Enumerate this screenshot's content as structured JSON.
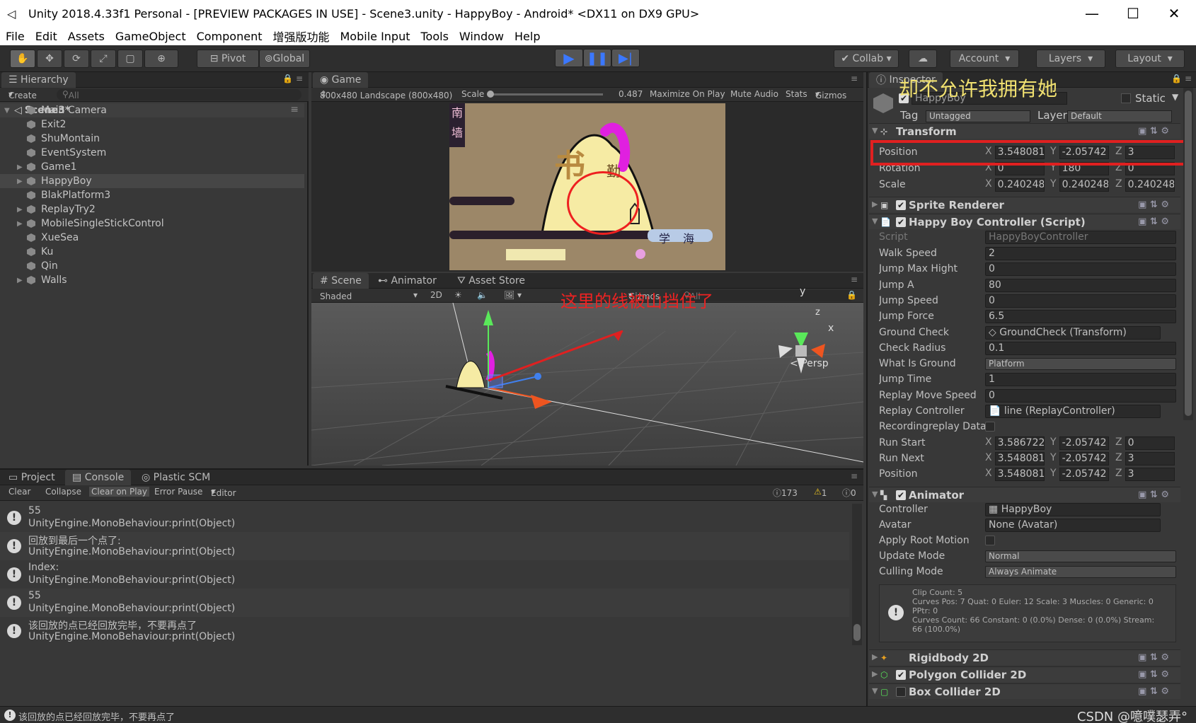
{
  "window": {
    "title": "Unity 2018.4.33f1 Personal - [PREVIEW PACKAGES IN USE] - Scene3.unity - HappyBoy - Android* <DX11 on DX9 GPU>",
    "min": "—",
    "max": "☐",
    "close": "✕"
  },
  "menu": [
    "File",
    "Edit",
    "Assets",
    "GameObject",
    "Component",
    "增强版功能",
    "Mobile Input",
    "Tools",
    "Window",
    "Help"
  ],
  "toolbar": {
    "pivot": "Pivot",
    "global": "Global",
    "collab": "Collab",
    "account": "Account",
    "layers": "Layers",
    "layout": "Layout"
  },
  "hierarchy": {
    "tab": "Hierarchy",
    "create": "Create",
    "search": "All",
    "scene": "Scene3*",
    "items": [
      {
        "name": "Main Camera",
        "expand": false,
        "selected": false
      },
      {
        "name": "Exit2",
        "expand": false,
        "selected": false
      },
      {
        "name": "ShuMontain",
        "expand": false,
        "selected": false
      },
      {
        "name": "EventSystem",
        "expand": false,
        "selected": false
      },
      {
        "name": "Game1",
        "expand": true,
        "selected": false
      },
      {
        "name": "HappyBoy",
        "expand": true,
        "selected": true
      },
      {
        "name": "BlakPlatform3",
        "expand": false,
        "selected": false
      },
      {
        "name": "ReplayTry2",
        "expand": true,
        "selected": false
      },
      {
        "name": "MobileSingleStickControl",
        "expand": true,
        "selected": false
      },
      {
        "name": "XueSea",
        "expand": false,
        "selected": false
      },
      {
        "name": "Ku",
        "expand": false,
        "selected": false
      },
      {
        "name": "Qin",
        "expand": false,
        "selected": false
      },
      {
        "name": "Walls",
        "expand": true,
        "selected": false
      }
    ]
  },
  "game": {
    "tab": "Game",
    "resolution": "800x480 Landscape (800x480)",
    "scale_label": "Scale",
    "scale_value": "0.487",
    "maximize": "Maximize On Play",
    "mute": "Mute Audio",
    "stats": "Stats",
    "gizmos": "Gizmos",
    "sign_top": "南",
    "sign_bottom": "墙",
    "xue": "学",
    "hai": "海",
    "qin": "勤",
    "shu": "书"
  },
  "scene": {
    "tabs": [
      "Scene",
      "Animator",
      "Asset Store"
    ],
    "shaded": "Shaded",
    "mode2d": "2D",
    "gizmos": "Gizmos",
    "search": "All",
    "persp": "Persp",
    "axis_y": "y",
    "axis_x": "x",
    "axis_z": "z"
  },
  "annotations": {
    "top": "却不允许我拥有她",
    "middle": "这里的线被山挡住了"
  },
  "console": {
    "tabs": [
      "Project",
      "Console",
      "Plastic SCM"
    ],
    "buttons": [
      "Clear",
      "Collapse",
      "Clear on Play",
      "Error Pause",
      "Editor"
    ],
    "counts": {
      "info": "173",
      "warn": "1",
      "error": "0"
    },
    "rows": [
      {
        "line1": "55",
        "line2": "UnityEngine.MonoBehaviour:print(Object)"
      },
      {
        "line1": "回放到最后一个点了:",
        "line2": "UnityEngine.MonoBehaviour:print(Object)"
      },
      {
        "line1": "Index:",
        "line2": "UnityEngine.MonoBehaviour:print(Object)"
      },
      {
        "line1": "55",
        "line2": "UnityEngine.MonoBehaviour:print(Object)"
      },
      {
        "line1": "该回放的点已经回放完毕，不要再点了",
        "line2": "UnityEngine.MonoBehaviour:print(Object)"
      }
    ]
  },
  "inspector": {
    "tab": "Inspector",
    "object_name": "HappyBoy",
    "static": "Static",
    "tag_label": "Tag",
    "tag_value": "Untagged",
    "layer_label": "Layer",
    "layer_value": "Default",
    "transform": {
      "header": "Transform",
      "position": [
        "Position",
        "3.548081",
        "-2.05742",
        "3"
      ],
      "rotation": [
        "Rotation",
        "0",
        "180",
        "0"
      ],
      "scale": [
        "Scale",
        "0.240248",
        "0.240248",
        "0.240248"
      ]
    },
    "sprite_renderer": "Sprite Renderer",
    "controller": {
      "header": "Happy Boy Controller (Script)",
      "script_label": "Script",
      "script_value": "HappyBoyController",
      "fields": [
        [
          "Walk Speed",
          "2"
        ],
        [
          "Jump Max Hight",
          "0"
        ],
        [
          "Jump A",
          "80"
        ],
        [
          "Jump Speed",
          "0"
        ],
        [
          "Jump Force",
          "6.5"
        ],
        [
          "Ground Check",
          "GroundCheck (Transform)"
        ],
        [
          "Check Radius",
          "0.1"
        ],
        [
          "What Is Ground",
          "Platform"
        ],
        [
          "Jump Time",
          "1"
        ],
        [
          "Replay Move Speed",
          "0"
        ],
        [
          "Replay Controller",
          "line (ReplayController)"
        ],
        [
          "Recordingreplay Data",
          ""
        ]
      ],
      "run_start": [
        "Run Start",
        "3.586722",
        "-2.05742",
        "0"
      ],
      "run_next": [
        "Run Next",
        "3.548081",
        "-2.05742",
        "3"
      ],
      "position": [
        "Position",
        "3.548081",
        "-2.05742",
        "3"
      ]
    },
    "animator": {
      "header": "Animator",
      "controller": [
        "Controller",
        "HappyBoy"
      ],
      "avatar": [
        "Avatar",
        "None (Avatar)"
      ],
      "apply_root": "Apply Root Motion",
      "update_mode": [
        "Update Mode",
        "Normal"
      ],
      "culling_mode": [
        "Culling Mode",
        "Always Animate"
      ],
      "info": [
        "Clip Count: 5",
        "Curves Pos: 7 Quat: 0 Euler: 12 Scale: 3 Muscles: 0 Generic: 0",
        "PPtr: 0",
        "Curves Count: 66 Constant: 0 (0.0%) Dense: 0 (0.0%) Stream:",
        "66 (100.0%)"
      ]
    },
    "rigidbody": "Rigidbody 2D",
    "polygon": "Polygon Collider 2D",
    "box": "Box Collider 2D"
  },
  "status": {
    "message": "该回放的点已经回放完毕，不要再点了",
    "watermark": "CSDN @噫噗瑟弄°"
  },
  "colors": {
    "accent": "#e02020",
    "selection": "#464646",
    "play": "#3b78ff"
  }
}
